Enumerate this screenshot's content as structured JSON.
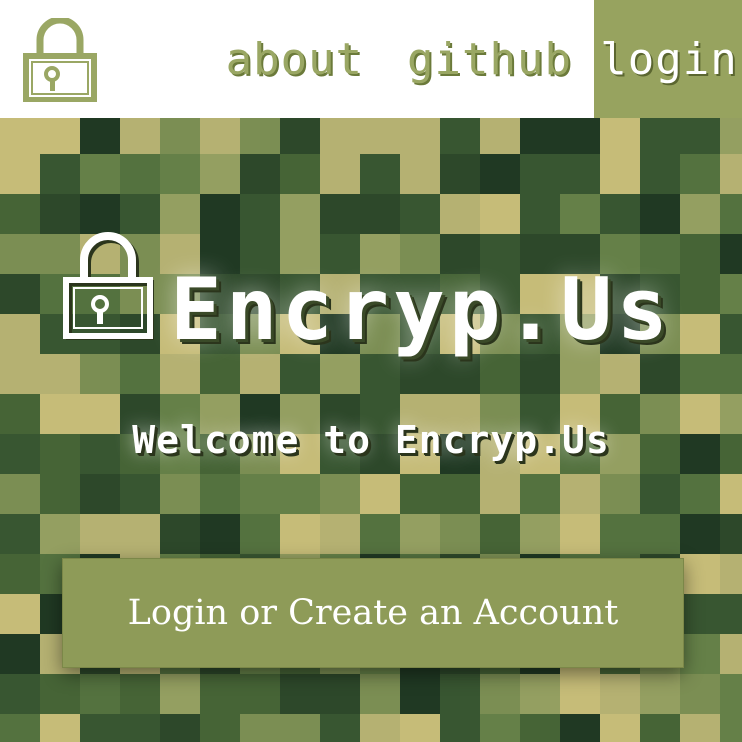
{
  "header": {
    "logo_icon": "lock-icon",
    "nav": {
      "about": "about",
      "github": "github",
      "login": "login"
    }
  },
  "hero": {
    "brand_icon": "lock-icon",
    "brand_name": "Encryp.Us",
    "welcome": "Welcome to Encryp.Us",
    "cta_label": "Login or Create an Account"
  },
  "colors": {
    "accent": "#97a35f",
    "nav_text": "#9aa764",
    "mosaic_palette": [
      "#2e4a2c",
      "#3b5a34",
      "#4a6a3a",
      "#5a7a44",
      "#6e8a4e",
      "#879a5a",
      "#a3ae6a",
      "#c9c27e",
      "#dccf85",
      "#1f3a24"
    ]
  }
}
